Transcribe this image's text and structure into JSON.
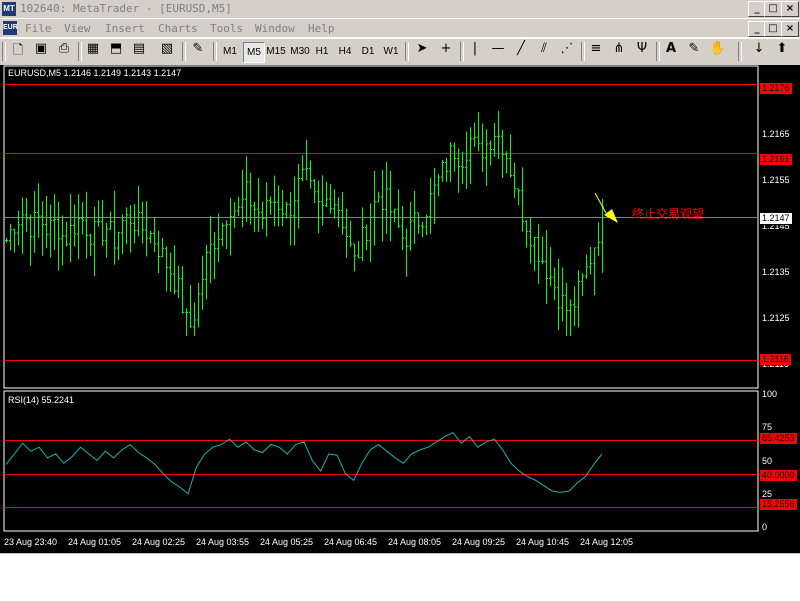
{
  "window": {
    "title": "102640: MetaTrader - [EURUSD,M5]",
    "app_icon": "MT",
    "doc_icon": "EUR"
  },
  "window_buttons": {
    "outer": [
      "_",
      "□",
      "×"
    ],
    "inner": [
      "_",
      "□",
      "×"
    ]
  },
  "menu": [
    "File",
    "View",
    "Insert",
    "Charts",
    "Tools",
    "Window",
    "Help"
  ],
  "toolbar": {
    "timeframes": [
      "M1",
      "M5",
      "M15",
      "M30",
      "H1",
      "H4",
      "D1",
      "W1"
    ],
    "active_timeframe": "M5",
    "icons": [
      "new-chart-icon",
      "save-icon",
      "print-icon",
      "indicators-icon",
      "navigator-icon",
      "terminal-icon",
      "properties-icon",
      "pencil-icon",
      "cursor-icon",
      "crosshair-icon",
      "vertical-line-icon",
      "horizontal-line-icon",
      "trendline-icon",
      "channel-icon",
      "gann-fan-icon",
      "fibonacci-icon",
      "pitchfork-icon",
      "andrews-icon",
      "text-icon",
      "label-icon",
      "arrow-down-icon",
      "arrow-thumb-icon"
    ]
  },
  "price_pane": {
    "header": "EURUSD,M5  1.2146 1.2149 1.2143 1.2147",
    "axis_ticks": [
      "1.2165",
      "1.2155",
      "1.2145",
      "1.2135",
      "1.2125",
      "1.2115"
    ],
    "levels": [
      "1.2176",
      "1.2161",
      "1.2116"
    ],
    "current_price": "1.2147",
    "annotation": "终止交易观望"
  },
  "rsi_pane": {
    "header": "RSI(14)  55.2241",
    "axis_ticks": [
      "100",
      "75",
      "50",
      "25",
      "0"
    ],
    "levels": [
      "65.4253",
      "40.0000",
      "15.2556"
    ]
  },
  "time_axis": [
    "23 Aug 23:40",
    "24 Aug 01:05",
    "24 Aug 02:25",
    "24 Aug 03:55",
    "24 Aug 05:25",
    "24 Aug 06:45",
    "24 Aug 08:05",
    "24 Aug 09:25",
    "24 Aug 10:45",
    "24 Aug 12:05"
  ],
  "chart_data": {
    "type": "candlestick-ohlc",
    "symbol": "EURUSD",
    "timeframe": "M5",
    "price_ylim": [
      1.2111,
      1.2179
    ],
    "rsi_ylim": [
      0,
      100
    ],
    "horizontal_levels": [
      1.2176,
      1.2161,
      1.2116
    ],
    "current_price": 1.2147,
    "last_bar": {
      "open": 1.2146,
      "high": 1.2149,
      "low": 1.2143,
      "close": 1.2147
    },
    "close_path": [
      1.2142,
      1.2146,
      1.2148,
      1.2145,
      1.2147,
      1.2144,
      1.2146,
      1.2142,
      1.2145,
      1.2147,
      1.2144,
      1.2143,
      1.2145,
      1.2142,
      1.2146,
      1.2147,
      1.2145,
      1.2144,
      1.2142,
      1.2138,
      1.2135,
      1.213,
      1.2122,
      1.2128,
      1.2137,
      1.2142,
      1.2145,
      1.215,
      1.2148,
      1.2152,
      1.2149,
      1.2147,
      1.2151,
      1.215,
      1.2148,
      1.2153,
      1.2156,
      1.2151,
      1.2148,
      1.2152,
      1.215,
      1.2144,
      1.2137,
      1.2142,
      1.2148,
      1.2152,
      1.215,
      1.2146,
      1.2142,
      1.2145,
      1.2147,
      1.215,
      1.2154,
      1.2158,
      1.2162,
      1.216,
      1.2164,
      1.2161,
      1.2163,
      1.2166,
      1.2163,
      1.2157,
      1.215,
      1.2145,
      1.2141,
      1.2137,
      1.2133,
      1.2129,
      1.2126,
      1.213,
      1.2135,
      1.2141,
      1.2147
    ],
    "rsi_values": [
      47,
      55,
      63,
      57,
      60,
      52,
      55,
      48,
      53,
      60,
      55,
      50,
      57,
      52,
      58,
      62,
      56,
      52,
      47,
      40,
      34,
      30,
      25,
      45,
      55,
      60,
      62,
      66,
      60,
      64,
      58,
      56,
      62,
      60,
      55,
      62,
      64,
      50,
      42,
      55,
      54,
      40,
      35,
      48,
      58,
      62,
      57,
      52,
      48,
      55,
      58,
      60,
      64,
      68,
      71,
      63,
      68,
      60,
      64,
      66,
      58,
      48,
      42,
      38,
      35,
      31,
      27,
      26,
      27,
      33,
      38,
      47,
      55
    ]
  }
}
